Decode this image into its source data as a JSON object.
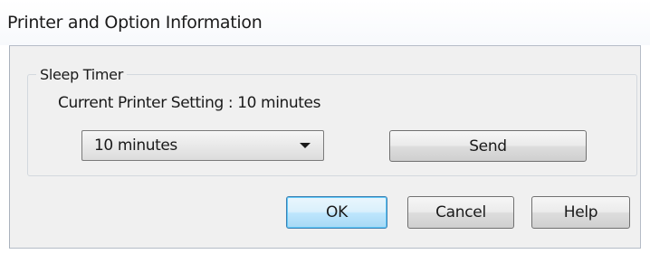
{
  "window": {
    "title": "Printer and Option Information"
  },
  "sleep_timer": {
    "group_label": "Sleep Timer",
    "current_setting_text": "Current Printer Setting : 10 minutes",
    "selected_value": "10 minutes",
    "send_label": "Send"
  },
  "buttons": {
    "ok_label": "OK",
    "cancel_label": "Cancel",
    "help_label": "Help"
  },
  "colors": {
    "dialog_background": "#f0f0f0",
    "default_button_border": "#3c7fb1"
  }
}
